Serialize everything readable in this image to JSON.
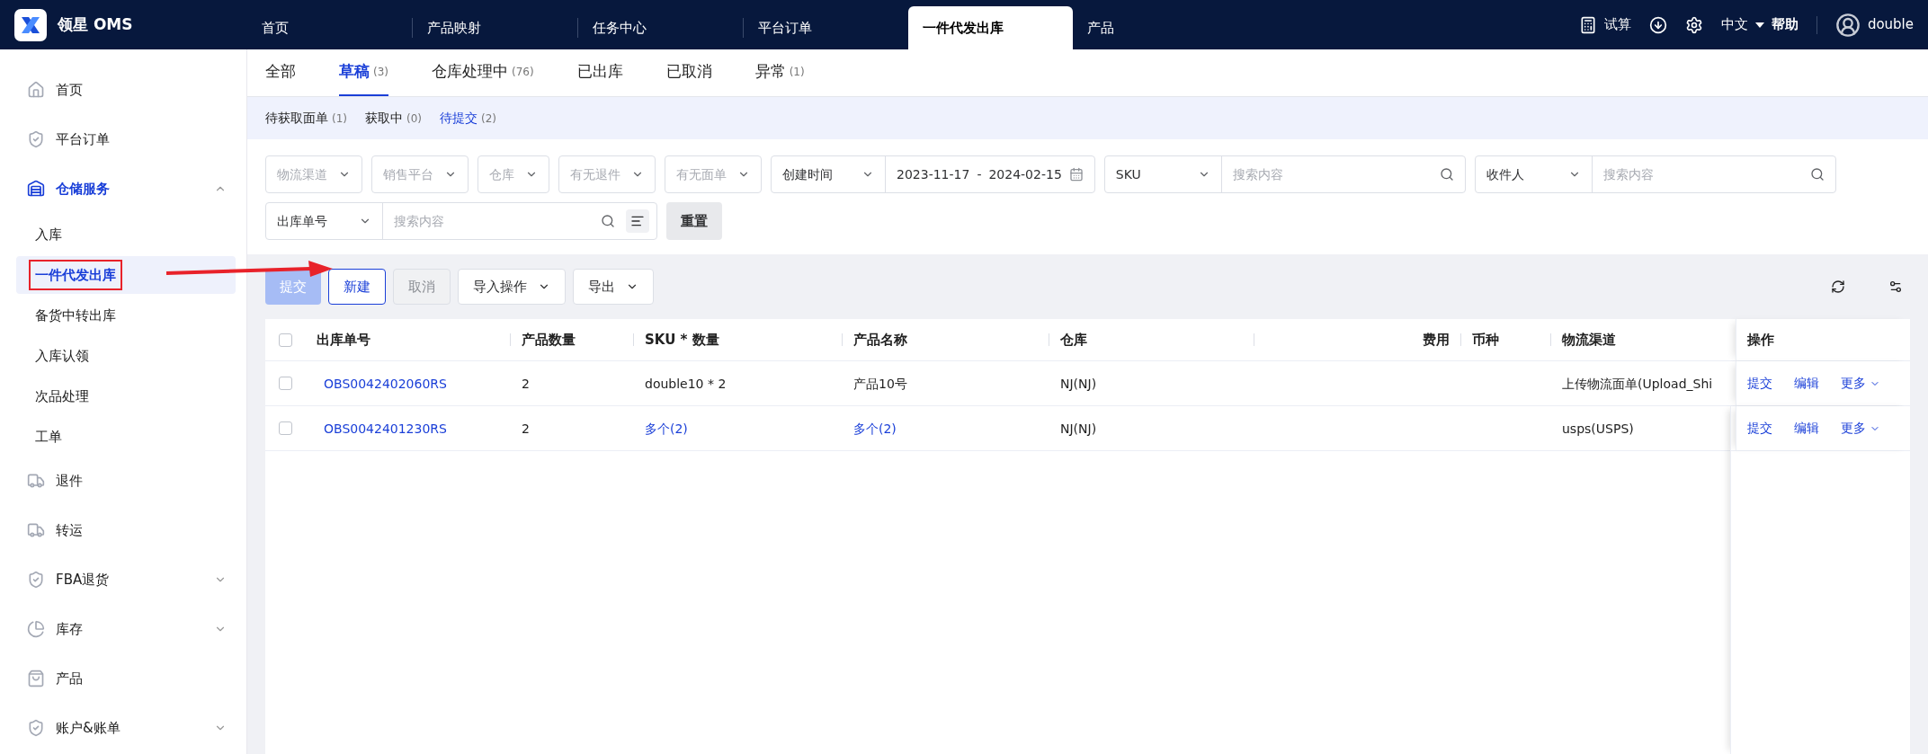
{
  "app": {
    "logo_text": "领星 OMS"
  },
  "top_nav": {
    "tabs": [
      {
        "label": "首页",
        "selected": false
      },
      {
        "label": "产品映射",
        "selected": false
      },
      {
        "label": "任务中心",
        "selected": false
      },
      {
        "label": "平台订单",
        "selected": false
      },
      {
        "label": "一件代发出库",
        "selected": true
      },
      {
        "label": "产品",
        "selected": false
      }
    ],
    "calc": "试算",
    "language": "中文",
    "help": "帮助",
    "user": "double"
  },
  "sidebar": {
    "items": [
      {
        "label": "首页",
        "active": false
      },
      {
        "label": "平台订单",
        "active": false
      },
      {
        "label": "仓储服务",
        "active": true,
        "expanded": true,
        "children": [
          {
            "label": "入库",
            "selected": false,
            "highlighted": false
          },
          {
            "label": "一件代发出库",
            "selected": true,
            "highlighted": true
          },
          {
            "label": "备货中转出库",
            "selected": false,
            "highlighted": false
          },
          {
            "label": "入库认领",
            "selected": false,
            "highlighted": false
          },
          {
            "label": "次品处理",
            "selected": false,
            "highlighted": false
          },
          {
            "label": "工单",
            "selected": false,
            "highlighted": false
          }
        ]
      },
      {
        "label": "退件",
        "active": false
      },
      {
        "label": "转运",
        "active": false
      },
      {
        "label": "FBA退货",
        "active": false,
        "expanded": false
      },
      {
        "label": "库存",
        "active": false,
        "expanded": false
      },
      {
        "label": "产品",
        "active": false
      },
      {
        "label": "账户&账单",
        "active": false,
        "expanded": false
      }
    ]
  },
  "tabs": [
    {
      "label": "全部",
      "selected": false
    },
    {
      "label": "草稿",
      "count": "(3)",
      "selected": true
    },
    {
      "label": "仓库处理中",
      "count": "(76)",
      "selected": false
    },
    {
      "label": "已出库",
      "selected": false
    },
    {
      "label": "已取消",
      "selected": false
    },
    {
      "label": "异常",
      "count": "(1)",
      "selected": false
    }
  ],
  "sub_tabs": [
    {
      "label": "待获取面单",
      "count": "(1)",
      "selected": false
    },
    {
      "label": "获取中",
      "count": "(0)",
      "selected": false
    },
    {
      "label": "待提交",
      "count": "(2)",
      "selected": true
    }
  ],
  "filter_rows": [
    [
      {
        "kind": "select",
        "placeholder": "物流渠道"
      },
      {
        "kind": "select",
        "placeholder": "销售平台"
      },
      {
        "kind": "select",
        "placeholder": "仓库"
      },
      {
        "kind": "select",
        "placeholder": "有无退件"
      },
      {
        "kind": "select",
        "placeholder": "有无面单"
      },
      {
        "kind": "date_range",
        "field": "创建时间",
        "start": "2023-11-17",
        "separator": "-",
        "end": "2024-02-15"
      },
      {
        "kind": "search",
        "field": "SKU",
        "placeholder": "搜索内容"
      },
      {
        "kind": "search",
        "field": "收件人",
        "placeholder": "搜索内容"
      }
    ],
    [
      {
        "kind": "search",
        "field": "出库单号",
        "placeholder": "搜索内容",
        "advanced": true
      },
      {
        "kind": "button",
        "label": "重置"
      }
    ]
  ],
  "toolbar": {
    "buttons": [
      {
        "label": "提交",
        "kind": "primary",
        "disabled": true
      },
      {
        "label": "新建",
        "kind": "outline",
        "disabled": false
      },
      {
        "label": "取消",
        "kind": "default",
        "disabled": true
      },
      {
        "label": "导入操作",
        "kind": "dropdown",
        "disabled": false
      },
      {
        "label": "导出",
        "kind": "dropdown",
        "disabled": false
      }
    ]
  },
  "table": {
    "all_checked": false,
    "columns": [
      "出库单号",
      "产品数量",
      "SKU * 数量",
      "产品名称",
      "仓库",
      "费用",
      "币种",
      "物流渠道",
      "操作"
    ],
    "rows": [
      {
        "checked": false,
        "order_no": "OBS0042402060RS",
        "quantity": "2",
        "sku": {
          "text": "double10 * 2",
          "link": false
        },
        "product": {
          "text": "产品10号",
          "link": false
        },
        "warehouse": "NJ(NJ)",
        "channel": "上传物流面单(Upload_Shi",
        "actions": [
          {
            "label": "提交",
            "kind": "link"
          },
          {
            "label": "编辑",
            "kind": "link"
          },
          {
            "label": "更多",
            "kind": "dropdown"
          }
        ]
      },
      {
        "checked": false,
        "order_no": "OBS0042401230RS",
        "quantity": "2",
        "sku": {
          "text": "多个(2)",
          "link": true
        },
        "product": {
          "text": "多个(2)",
          "link": true
        },
        "warehouse": "NJ(NJ)",
        "channel": "usps(USPS)",
        "actions": [
          {
            "label": "提交",
            "kind": "link"
          },
          {
            "label": "编辑",
            "kind": "link"
          },
          {
            "label": "更多",
            "kind": "dropdown"
          }
        ]
      }
    ]
  }
}
